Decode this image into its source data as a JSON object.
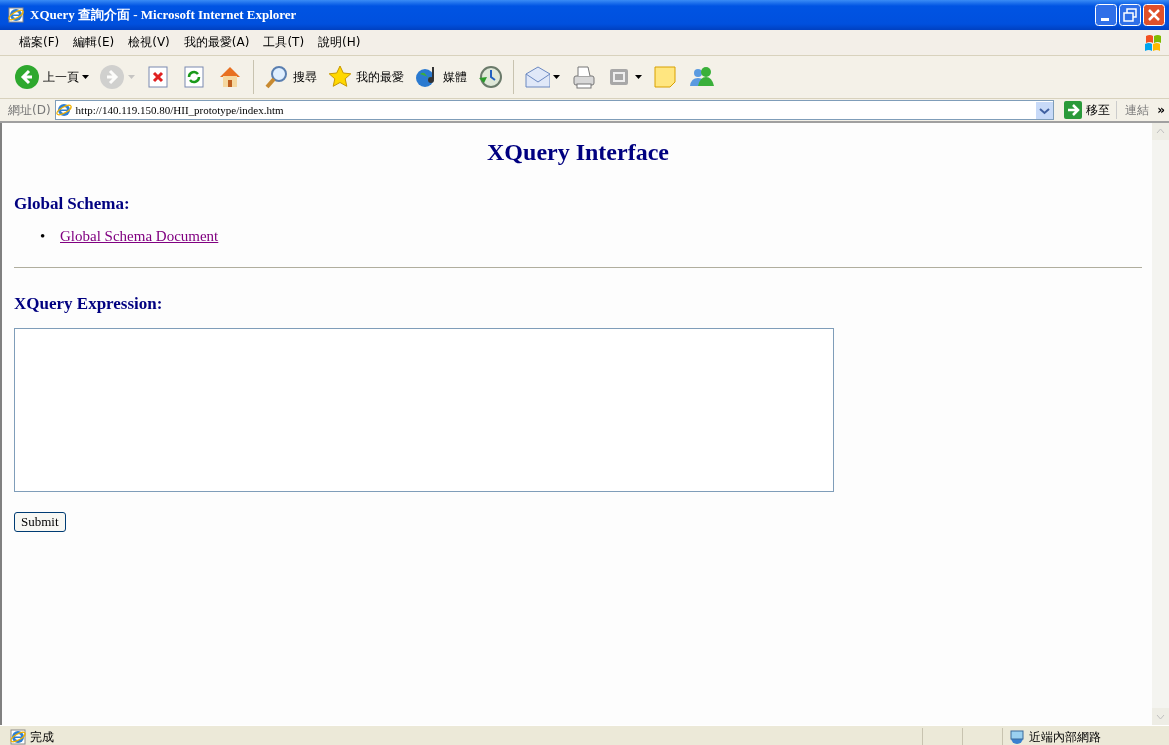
{
  "window": {
    "title": "XQuery 查詢介面 - Microsoft Internet Explorer"
  },
  "menu": [
    "檔案(F)",
    "編輯(E)",
    "檢視(V)",
    "我的最愛(A)",
    "工具(T)",
    "說明(H)"
  ],
  "toolbar": [
    {
      "kind": "button",
      "label": "上一頁",
      "dropdown": true,
      "disabled": false
    },
    {
      "kind": "button",
      "dropdown": true,
      "disabled": true
    },
    {
      "kind": "button",
      "dropdown": false,
      "disabled": false
    },
    {
      "kind": "button",
      "dropdown": false,
      "disabled": false
    },
    {
      "kind": "button",
      "dropdown": false,
      "disabled": false
    },
    {
      "kind": "separator"
    },
    {
      "kind": "button",
      "label": "搜尋",
      "dropdown": false,
      "disabled": false
    },
    {
      "kind": "button",
      "label": "我的最愛",
      "dropdown": false,
      "disabled": false
    },
    {
      "kind": "button",
      "label": "媒體",
      "dropdown": false,
      "disabled": false
    },
    {
      "kind": "button",
      "dropdown": false,
      "disabled": false
    },
    {
      "kind": "separator"
    },
    {
      "kind": "button",
      "dropdown": true,
      "disabled": false
    },
    {
      "kind": "button",
      "dropdown": false,
      "disabled": false
    },
    {
      "kind": "button",
      "dropdown": true,
      "disabled": false
    },
    {
      "kind": "button",
      "dropdown": false,
      "disabled": false
    },
    {
      "kind": "button",
      "dropdown": false,
      "disabled": false
    }
  ],
  "address": {
    "label": "網址(D)",
    "url": "http://140.119.150.80/HII_prototype/index.htm",
    "go": "移至",
    "links": "連結",
    "more": "»"
  },
  "page": {
    "heading": "XQuery Interface",
    "sections": [
      {
        "heading": "Global Schema:",
        "links": [
          {
            "marker": "•",
            "text": "Global Schema Document"
          }
        ]
      }
    ],
    "form": {
      "heading": "XQuery Expression:",
      "submit": "Submit"
    }
  },
  "status_bar": {
    "text": "完成",
    "zone": "近端內部網路"
  }
}
